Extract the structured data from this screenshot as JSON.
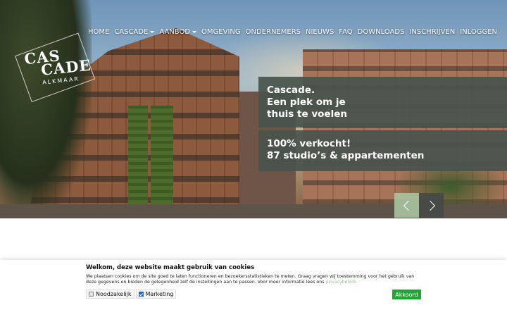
{
  "logo": {
    "lines": [
      "CAS",
      "CADE"
    ],
    "sub": "ALKMAAR"
  },
  "nav": {
    "items": [
      {
        "label": "HOME",
        "dropdown": false
      },
      {
        "label": "CASCADE",
        "dropdown": true
      },
      {
        "label": "AANBOD",
        "dropdown": true
      },
      {
        "label": "OMGEVING",
        "dropdown": false
      },
      {
        "label": "ONDERNEMERS",
        "dropdown": false
      },
      {
        "label": "NIEUWS",
        "dropdown": false
      },
      {
        "label": "FAQ",
        "dropdown": false
      },
      {
        "label": "DOWNLOADS",
        "dropdown": false
      },
      {
        "label": "INSCHRIJVEN",
        "dropdown": false
      },
      {
        "label": "INLOGGEN",
        "dropdown": false
      }
    ]
  },
  "hero": {
    "panel1": [
      "Cascade.",
      "Een plek om je",
      "thuis te voelen"
    ],
    "panel2": [
      "100% verkocht!",
      "87 studio’s & appartementen"
    ],
    "prev_icon": "chevron-left-icon",
    "next_icon": "chevron-right-icon"
  },
  "cookie": {
    "title": "Welkom, deze website maakt gebruik van cookies",
    "text": "We plaatsen cookies om de site goed te laten functioneren en bezoekersstatistieken te meten. Graag vragen wij toestemming voor het gebruik van deze gegevens en bieden de gelegenheid zelf de instellingen aan te passen. Voor meer informatie lees ons",
    "link": "privacybeleid",
    "link_suffix": ".",
    "options": [
      {
        "label": "Noodzakelijk",
        "checked": false
      },
      {
        "label": "Marketing",
        "checked": true
      }
    ],
    "accept": "Akkoord"
  },
  "colors": {
    "panel": "#48544c",
    "arrow_prev": "#a8c4a0",
    "arrow_next": "#464a48",
    "accept": "#1fa82f",
    "link": "#9fbf98"
  }
}
